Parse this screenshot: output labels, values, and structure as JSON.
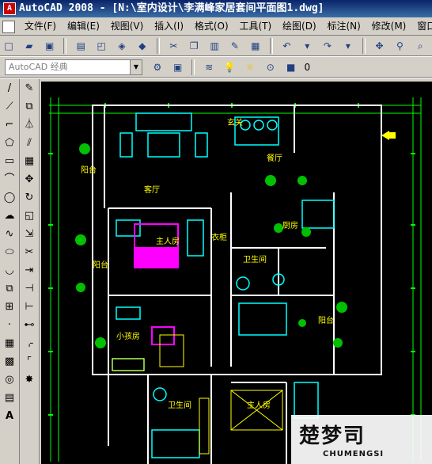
{
  "window": {
    "title": "AutoCAD 2008 - [N:\\室内设计\\李满峰家居套间平面图1.dwg]"
  },
  "menu": [
    "文件(F)",
    "编辑(E)",
    "视图(V)",
    "插入(I)",
    "格式(O)",
    "工具(T)",
    "绘图(D)",
    "标注(N)",
    "修改(M)",
    "窗口(W)"
  ],
  "toolbar": {
    "workspace": "AutoCAD 经典",
    "layer_name": "0"
  },
  "plan": {
    "rooms": [
      "阳台",
      "客厅",
      "餐厅",
      "厨房",
      "主人房",
      "衣柜",
      "卫生间",
      "阳台",
      "小孩房",
      "卫生间",
      "阳台",
      "主人房",
      "玄关"
    ]
  },
  "watermark": {
    "text": "楚梦司",
    "sub": "CHUMENGSI"
  },
  "colors": {
    "canvas": "#000000",
    "walls": "#ffffff",
    "furniture": "#00ffff",
    "text": "#ffff00",
    "dims": "#00ff00",
    "bed": "#ff00ff"
  }
}
